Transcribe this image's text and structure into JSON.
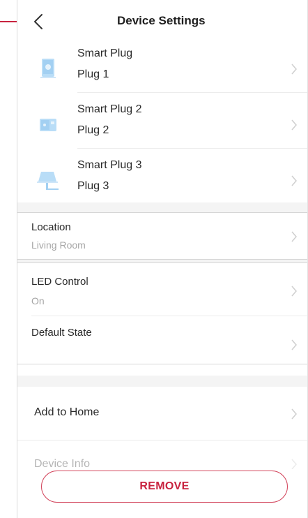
{
  "header": {
    "title": "Device Settings",
    "back_icon": "chevron-left-icon"
  },
  "devices": [
    {
      "name": "Smart Plug",
      "label": "Plug 1",
      "icon": "smart-plug-icon"
    },
    {
      "name": "Smart Plug 2",
      "label": "Plug 2",
      "icon": "smart-plug-icon"
    },
    {
      "name": "Smart Plug 3",
      "label": "Plug 3",
      "icon": "lamp-icon"
    }
  ],
  "location": {
    "label": "Location",
    "value": "Living Room"
  },
  "led_control": {
    "label": "LED Control",
    "value": "On"
  },
  "default_state": {
    "label": "Default State",
    "value": ""
  },
  "add_to_home": {
    "label": "Add to Home"
  },
  "device_info": {
    "label": "Device Info"
  },
  "remove_button": {
    "label": "REMOVE"
  },
  "colors": {
    "accent": "#c8233f",
    "icon_blue": "#9fcdf0",
    "divider": "#ececec",
    "muted_text": "#a6a6a6"
  }
}
